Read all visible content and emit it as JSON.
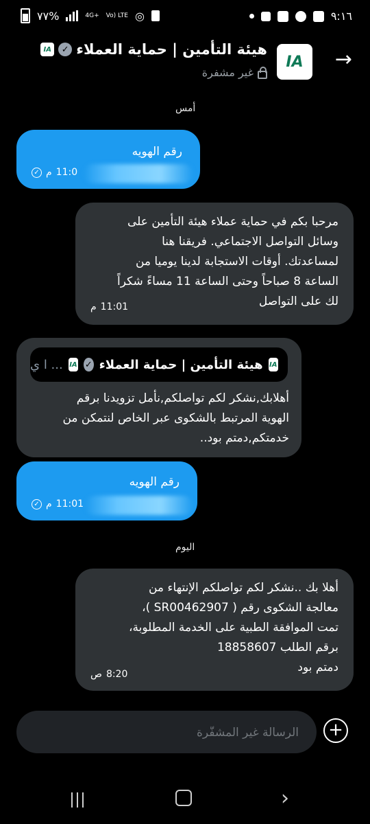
{
  "status_bar": {
    "time": "٩:١٦",
    "battery": "%٧٧",
    "network_4g": "4G+",
    "network_volte": "Vo) LTE"
  },
  "header": {
    "back_icon": "arrow-right-icon",
    "avatar_text": "IA",
    "title": "هيئة التأمين | حماية العملاء",
    "subtitle": "غير مشفرة"
  },
  "messages": {
    "day_yesterday": "أمس",
    "m1": {
      "text": "رقم الهويه",
      "time": "11:0",
      "ampm": "م"
    },
    "m2": {
      "text": "مرحبا بكم في حماية عملاء هيئة التأمين على\nوسائل التواصل الاجتماعي. فريقنا هنا\nلمساعدتك. أوقات الاستجابة لدينا يوميا من\nالساعة 8 صباحاً وحتى الساعة 11 مساءً شكراً\nلك على التواصل",
      "time": "11:01",
      "ampm": "م"
    },
    "m3": {
      "quote_name": "هيئة التأمين | حماية العملاء",
      "quote_more": "... ا ي",
      "text": "أهلابك,نشكر لكم تواصلكم,نأمل تزويدنا برقم\nالهوية المرتبط بالشكوى عبر الخاص لنتمكن من\nخدمتكم,دمتم بود.."
    },
    "m4": {
      "text": "رقم الهويه",
      "time": "11:01",
      "ampm": "م"
    },
    "day_today": "اليوم",
    "m5": {
      "text": "أهلا بك ..نشكر لكم تواصلكم الإنتهاء من\nمعالجة الشكوى رقم ( SR00462907 )،\nتمت الموافقة الطبية على الخدمة المطلوبة،\nبرقم الطلب  18858607\nدمتم بود",
      "time": "8:20",
      "ampm": "ص"
    }
  },
  "composer": {
    "placeholder": "الرسالة غير المشفَّرة"
  },
  "colors": {
    "outgoing": "#1d9bf0",
    "incoming": "#2f3336",
    "background": "#000000"
  }
}
